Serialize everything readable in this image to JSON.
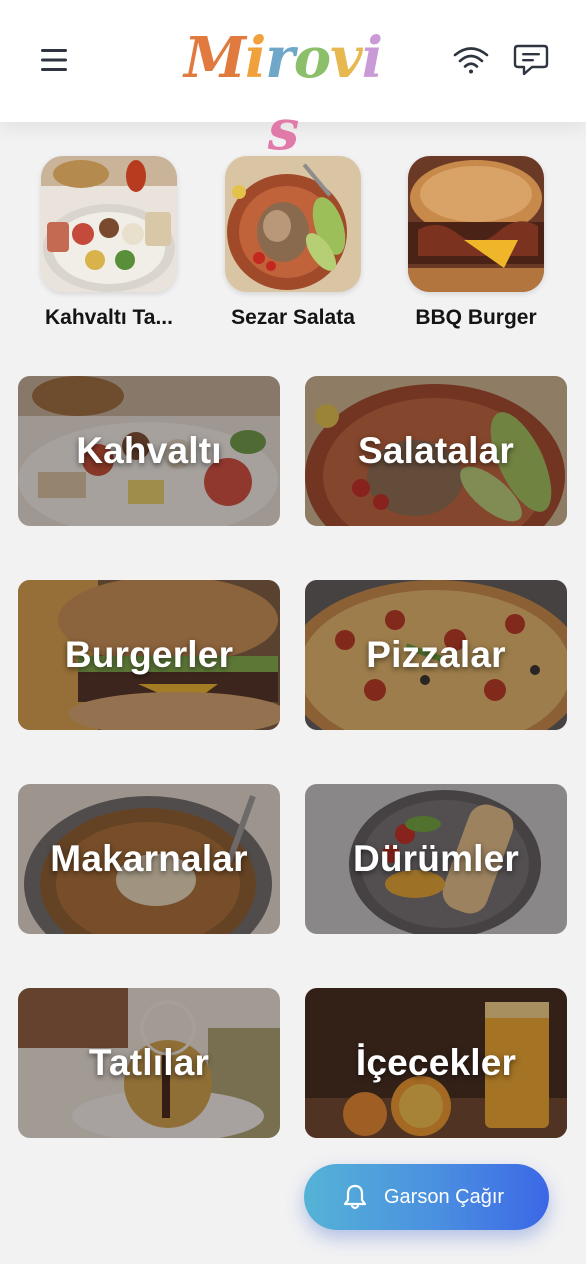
{
  "header": {
    "brand": "Mirovis",
    "icons": {
      "menu": "menu-icon",
      "wifi": "wifi-icon",
      "chat": "chat-icon"
    },
    "logo_colors": [
      "#e07a3f",
      "#f0a13c",
      "#6fa7c9",
      "#8cbf6a",
      "#e6b84f",
      "#c99ad6",
      "#e07aa8"
    ]
  },
  "featured": [
    {
      "label": "Kahvaltı Ta...",
      "image": "breakfast-plate"
    },
    {
      "label": "Sezar Salata",
      "image": "caesar-salad"
    },
    {
      "label": "BBQ Burger",
      "image": "bbq-burger"
    }
  ],
  "categories": [
    {
      "label": "Kahvaltı",
      "image": "breakfast"
    },
    {
      "label": "Salatalar",
      "image": "salad"
    },
    {
      "label": "Burgerler",
      "image": "burger"
    },
    {
      "label": "Pizzalar",
      "image": "pizza"
    },
    {
      "label": "Makarnalar",
      "image": "pasta"
    },
    {
      "label": "Dürümler",
      "image": "wrap"
    },
    {
      "label": "Tatlılar",
      "image": "dessert"
    },
    {
      "label": "İçecekler",
      "image": "drinks"
    }
  ],
  "call_waiter": {
    "label": "Garson Çağır",
    "icon": "bell-icon"
  },
  "colors": {
    "background": "#f2f2f3",
    "header": "#ffffff",
    "button_gradient_start": "#55b3d6",
    "button_gradient_end": "#3c67e6"
  }
}
